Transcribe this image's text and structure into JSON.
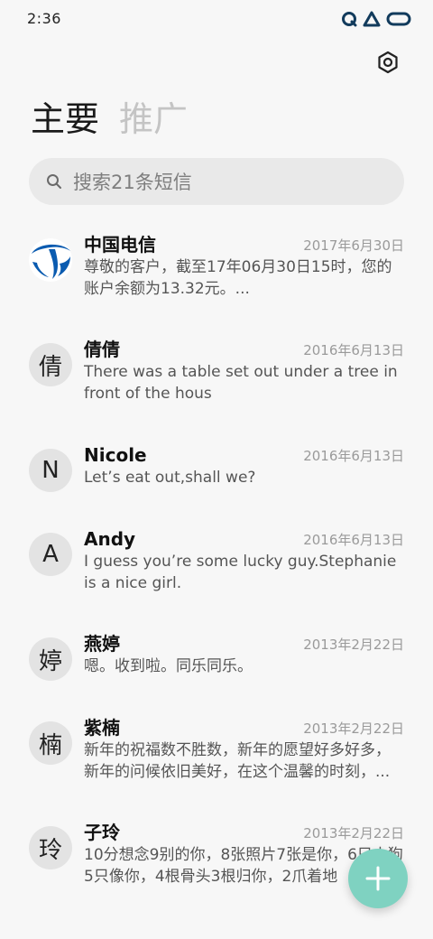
{
  "status_bar": {
    "time": "2:36",
    "icons": [
      "data-saver-icon",
      "network-triangle-icon",
      "battery-icon"
    ]
  },
  "toolbar": {
    "settings_icon": "gear-icon"
  },
  "tabs": [
    {
      "label": "主要",
      "active": true
    },
    {
      "label": "推广",
      "active": false
    }
  ],
  "search": {
    "placeholder": "搜索21条短信"
  },
  "conversations": [
    {
      "name": "中国电信",
      "date": "2017年6月30日",
      "snippet": "尊敬的客户，截至17年06月30日15时，您的账户余额为13.32元。...",
      "avatar": "",
      "avatar_icon": "china-telecom-logo-icon"
    },
    {
      "name": "倩倩",
      "date": "2016年6月13日",
      "snippet": "There was a table set out under a tree in front of the hous",
      "avatar": "倩"
    },
    {
      "name": "Nicole",
      "date": "2016年6月13日",
      "snippet": "Let’s eat out,shall we?",
      "avatar": "N"
    },
    {
      "name": "Andy",
      "date": "2016年6月13日",
      "snippet": "I guess you’re some lucky guy.Stephanie is a nice girl.",
      "avatar": "A"
    },
    {
      "name": "燕婷",
      "date": "2013年2月22日",
      "snippet": "嗯。收到啦。同乐同乐。",
      "avatar": "婷"
    },
    {
      "name": "紫楠",
      "date": "2013年2月22日",
      "snippet": "新年的祝福数不胜数，新年的愿望好多好多，新年的问候依旧美好，在这个温馨的时刻，...",
      "avatar": "楠"
    },
    {
      "name": "子玲",
      "date": "2013年2月22日",
      "snippet": "10分想念9别的你，8张照片7张是你，6只小狗5只像你，4根骨头3根归你，2爪着地",
      "avatar": "玲"
    }
  ],
  "fab": {
    "icon": "plus-icon"
  },
  "colors": {
    "background": "#f7f7f7",
    "search_bg": "#e9e9e9",
    "avatar_bg": "#e3e3e3",
    "fab": "#7fd2c1",
    "telecom_blue": "#0a5bb0"
  }
}
